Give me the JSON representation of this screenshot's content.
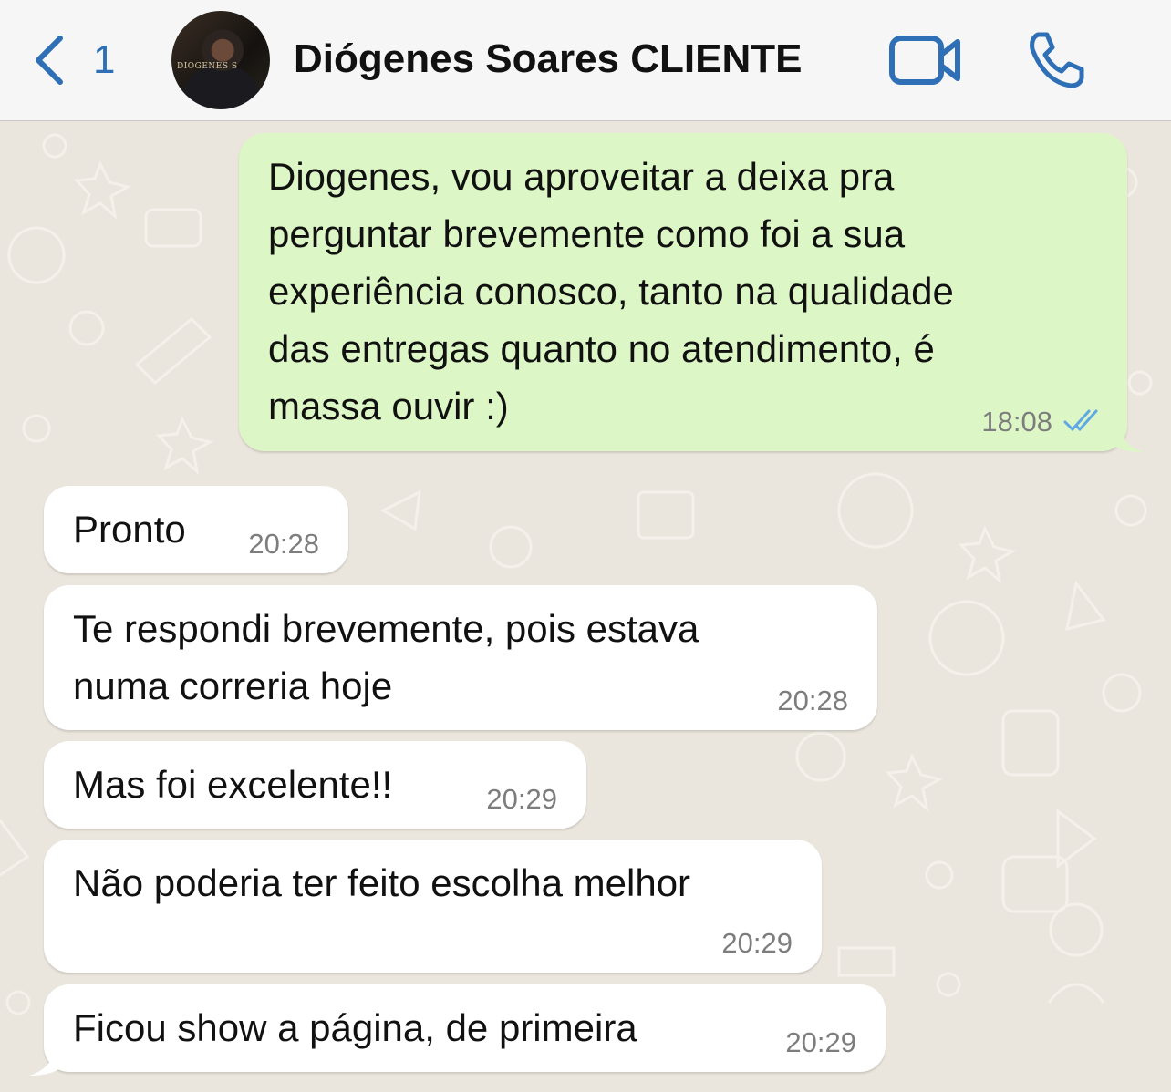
{
  "header": {
    "back_count": "1",
    "contact_name": "Diógenes Soares CLIENTE",
    "avatar_text": "DIOGENES S",
    "accent_color": "#2f6fb6",
    "icons": [
      "chevron-left-icon",
      "video-camera-icon",
      "phone-icon"
    ]
  },
  "messages": [
    {
      "direction": "outgoing",
      "text": "Diogenes, vou aproveitar a deixa pra\nperguntar brevemente como foi a sua\nexperiência conosco, tanto na qualidade\ndas entregas quanto no atendimento, é\nmassa ouvir :)",
      "time": "18:08",
      "status": "read"
    },
    {
      "direction": "incoming",
      "text": "Pronto",
      "time": "20:28"
    },
    {
      "direction": "incoming",
      "text": "Te respondi brevemente, pois estava\nnuma correria hoje",
      "time": "20:28"
    },
    {
      "direction": "incoming",
      "text": "Mas foi excelente!!",
      "time": "20:29"
    },
    {
      "direction": "incoming",
      "text": "Não poderia ter feito escolha melhor",
      "time": "20:29"
    },
    {
      "direction": "incoming",
      "text": "Ficou show a página, de primeira",
      "time": "20:29"
    }
  ],
  "colors": {
    "outgoing_bubble": "#dcf7c5",
    "incoming_bubble": "#ffffff",
    "chat_background": "#ebe6dd",
    "read_ticks": "#5ea8e6"
  }
}
